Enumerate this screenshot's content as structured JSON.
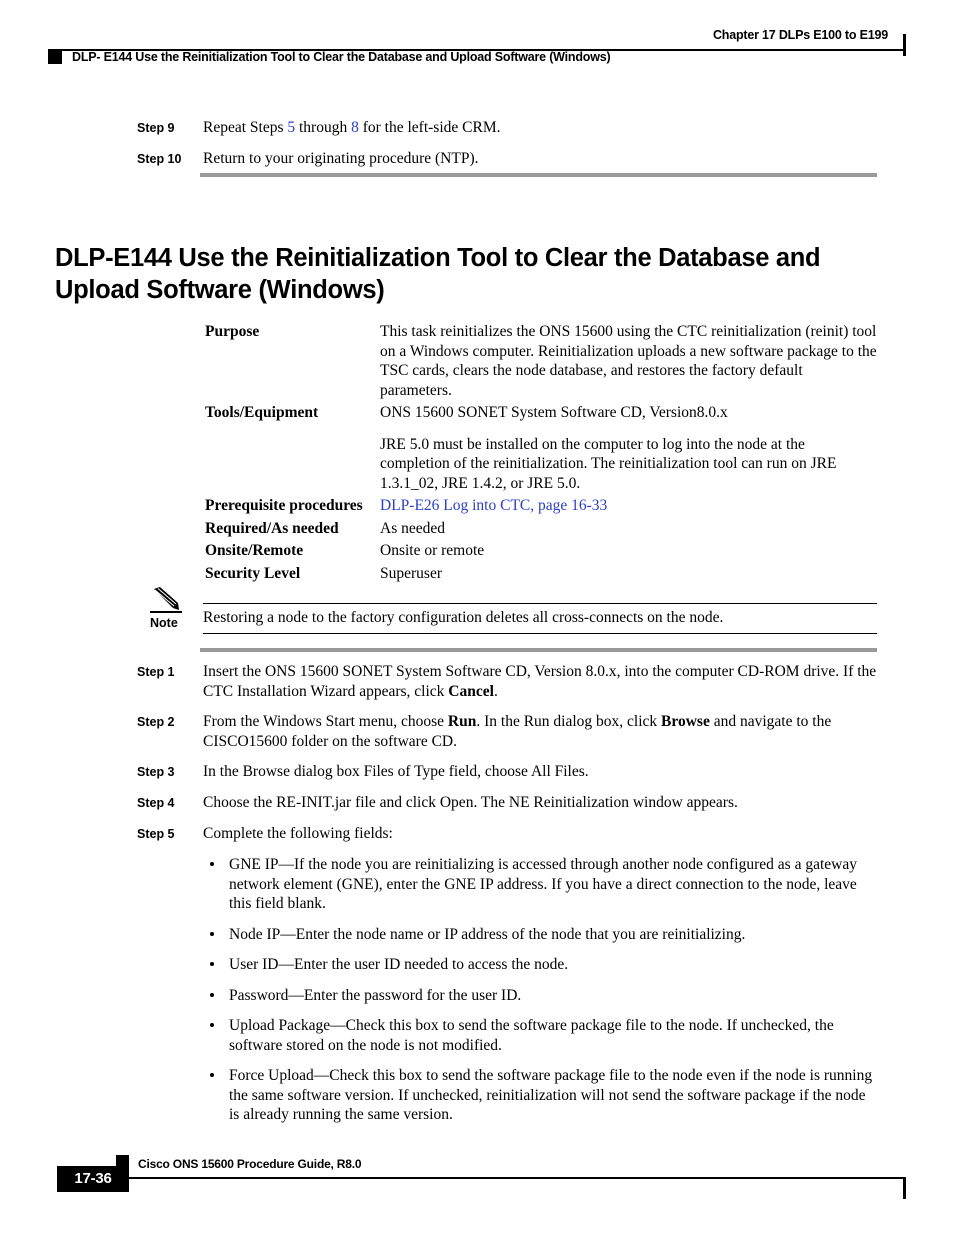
{
  "header": {
    "chapter": "Chapter 17 DLPs E100 to E199",
    "doc_title": "DLP- E144 Use the Reinitialization Tool to Clear the Database and Upload Software (Windows)",
    "marker_icon": "black-square-marker"
  },
  "top_steps": [
    {
      "label": "Step 9",
      "text_parts": [
        {
          "t": "Repeat Steps ",
          "style": "normal"
        },
        {
          "t": "5",
          "style": "xref"
        },
        {
          "t": " through ",
          "style": "normal"
        },
        {
          "t": "8",
          "style": "xref"
        },
        {
          "t": " for the left-side CRM.",
          "style": "normal"
        }
      ]
    },
    {
      "label": "Step 10",
      "text_parts": [
        {
          "t": "Return to your originating procedure (NTP).",
          "style": "normal"
        }
      ]
    }
  ],
  "heading": {
    "title": "DLP-E144 Use the Reinitialization Tool to Clear the Database and Upload Software (Windows)"
  },
  "spec_table": [
    {
      "term": "Purpose",
      "paragraphs": [
        "This task reinitializes the ONS 15600 using the CTC reinitialization (reinit) tool on a Windows computer. Reinitialization uploads a new software package to the TSC cards, clears the node database, and restores the factory default parameters."
      ]
    },
    {
      "term": "Tools/Equipment",
      "paragraphs": [
        "ONS 15600 SONET System Software CD, Version8.0.x",
        "JRE 5.0 must be installed on the computer to log into the node at the completion of the reinitialization. The reinitialization tool can run on JRE 1.3.1_02, JRE 1.4.2, or JRE 5.0."
      ]
    },
    {
      "term": "Prerequisite procedures",
      "link": "DLP-E26 Log into CTC, page 16-33"
    },
    {
      "term": "Required/As needed",
      "paragraphs": [
        "As needed"
      ]
    },
    {
      "term": "Onsite/Remote",
      "paragraphs": [
        "Onsite or remote"
      ]
    },
    {
      "term": "Security Level",
      "paragraphs": [
        "Superuser"
      ]
    }
  ],
  "note": {
    "icon": "pencil-icon",
    "label": "Note",
    "text": "Restoring a node to the factory configuration deletes all cross-connects on the node."
  },
  "main_steps": [
    {
      "label": "Step 1",
      "parts": [
        {
          "t": "Insert the ONS 15600 SONET System Software CD, Version 8.0.x, into the computer CD-ROM drive. If the CTC Installation Wizard appears, click ",
          "style": "normal"
        },
        {
          "t": "Cancel",
          "style": "bold"
        },
        {
          "t": ".",
          "style": "normal"
        }
      ]
    },
    {
      "label": "Step 2",
      "parts": [
        {
          "t": "From the Windows Start menu, choose ",
          "style": "normal"
        },
        {
          "t": "Run",
          "style": "bold"
        },
        {
          "t": ". In the Run dialog box, click ",
          "style": "normal"
        },
        {
          "t": "Browse",
          "style": "bold"
        },
        {
          "t": " and navigate to the CISCO15600 folder on the software CD.",
          "style": "normal"
        }
      ]
    },
    {
      "label": "Step 3",
      "parts": [
        {
          "t": "In the Browse dialog box Files of Type field, choose All Files.",
          "style": "normal"
        }
      ]
    },
    {
      "label": "Step 4",
      "parts": [
        {
          "t": "Choose the RE-INIT.jar file and click Open. The NE Reinitialization window appears.",
          "style": "normal"
        }
      ]
    },
    {
      "label": "Step 5",
      "parts": [
        {
          "t": "Complete the following fields:",
          "style": "normal"
        }
      ]
    }
  ],
  "step5_bullets": [
    "GNE IP—If the node you are reinitializing is accessed through another node configured as a gateway network element (GNE), enter the GNE IP address. If you have a direct connection to the node, leave this field blank.",
    "Node IP—Enter the node name or IP address of the node that you are reinitializing.",
    "User ID—Enter the user ID needed to access the node.",
    "Password—Enter the password for the user ID.",
    "Upload Package—Check this box to send the software package file to the node. If unchecked, the software stored on the node is not modified.",
    "Force Upload—Check this box to send the software package file to the node even if the node is running the same software version. If unchecked, reinitialization will not send the software package if the node is already running the same version."
  ],
  "footer": {
    "guide_title": "Cisco ONS 15600 Procedure Guide, R8.0",
    "page_number": "17-36",
    "marker_icon": "black-square-marker"
  },
  "colors": {
    "xref_blue": "#2c3fc4",
    "rule_gray": "#9a9a9a",
    "text_black": "#000000"
  }
}
